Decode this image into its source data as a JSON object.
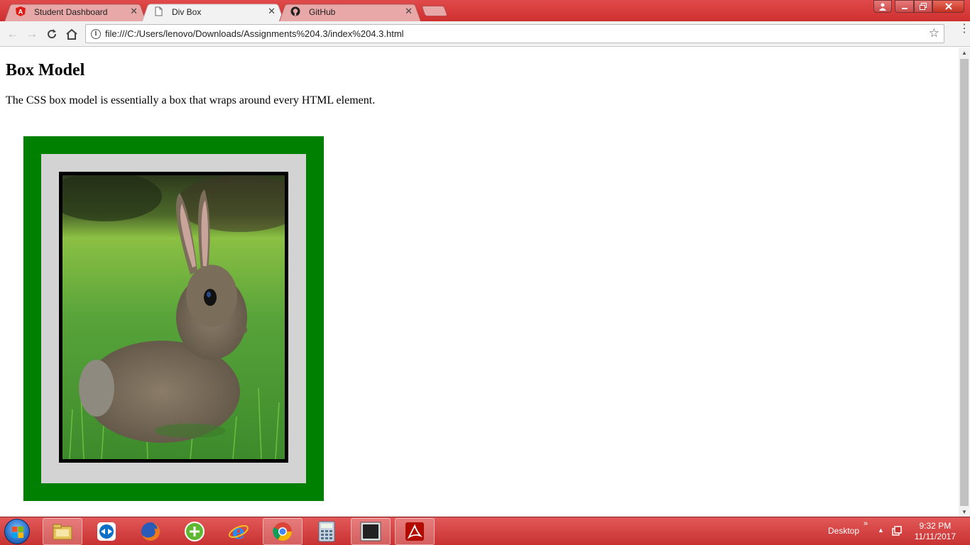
{
  "browser": {
    "tabs": [
      {
        "label": "Student Dashboard",
        "icon": "angular-icon",
        "active": false
      },
      {
        "label": "Div Box",
        "icon": "document-icon",
        "active": true
      },
      {
        "label": "GitHub",
        "icon": "github-icon",
        "active": false
      }
    ],
    "url": "file:///C:/Users/lenovo/Downloads/Assignments%204.3/index%204.3.html"
  },
  "page": {
    "title": "Box Model",
    "text": "The CSS box model is essentially a box that wraps around every HTML element.",
    "box_colors": {
      "margin": "#008000",
      "padding": "#d3d3d3",
      "border": "#000000"
    }
  },
  "taskbar": {
    "apps": [
      "file-explorer-icon",
      "teamviewer-icon",
      "firefox-icon",
      "software-updater-icon",
      "internet-explorer-icon",
      "chrome-icon",
      "calculator-icon",
      "console-icon",
      "acrobat-icon"
    ],
    "desktop_label": "Desktop",
    "overflow": "»",
    "time": "9:32 PM",
    "date": "11/11/2017"
  },
  "colors": {
    "accent": "#d83b3b",
    "page_margin_box": "#008000"
  }
}
